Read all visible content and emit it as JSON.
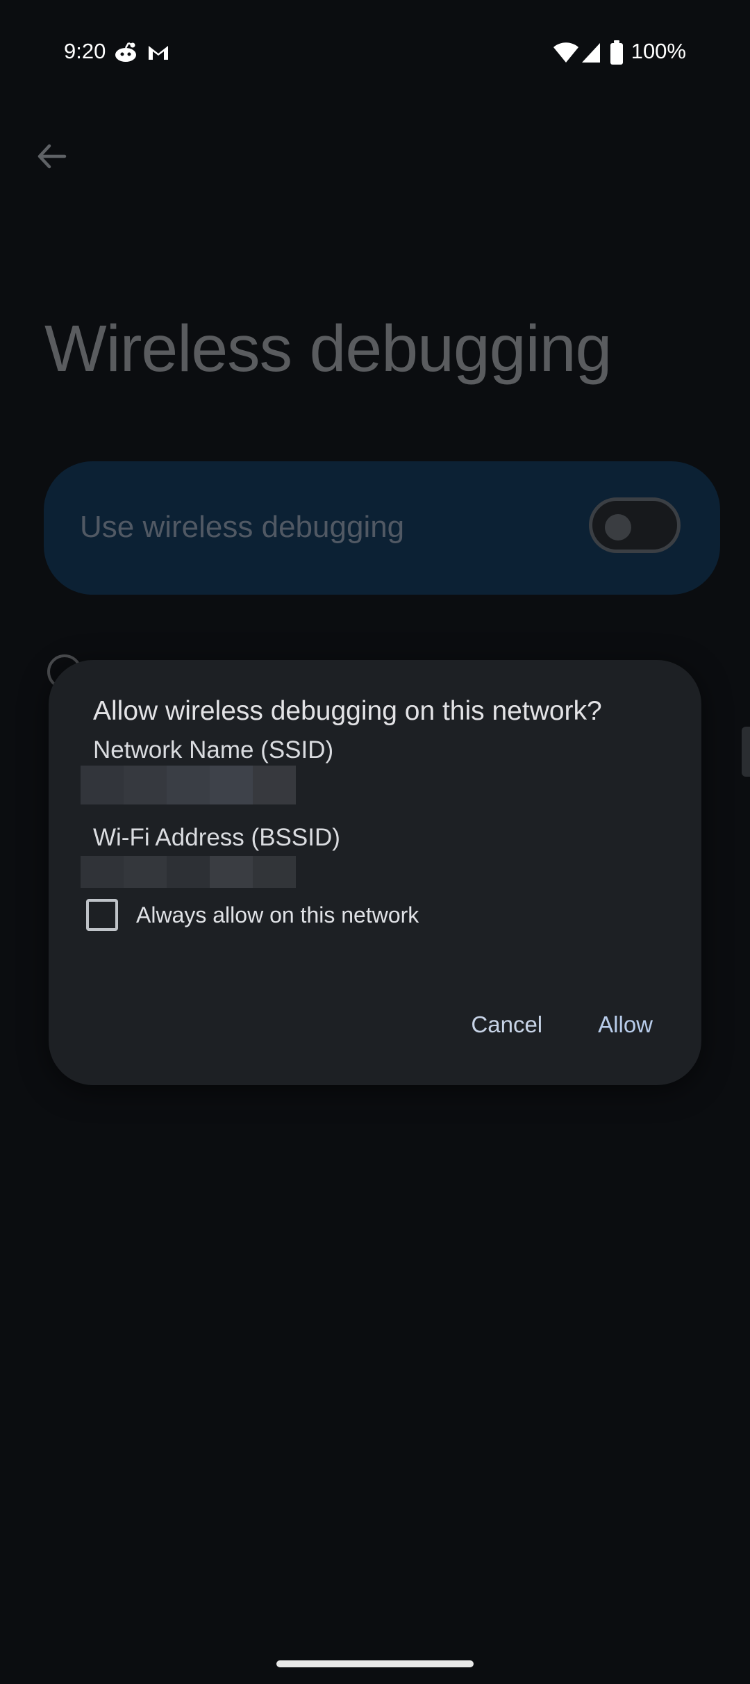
{
  "status_bar": {
    "time": "9:20",
    "notification_icons": [
      "reddit-icon",
      "gmail-icon"
    ],
    "system_icons": [
      "wifi-icon",
      "cell-signal-icon",
      "battery-icon"
    ],
    "battery_percent": "100%"
  },
  "app_bar": {
    "back_icon": "arrow-back-icon"
  },
  "page": {
    "title": "Wireless debugging"
  },
  "main_toggle": {
    "label": "Use wireless debugging",
    "enabled": false
  },
  "dialog": {
    "title": "Allow wireless debugging on this network?",
    "ssid_label": "Network Name (SSID)",
    "bssid_label": "Wi-Fi Address (BSSID)",
    "checkbox_label": "Always allow on this network",
    "checkbox_checked": false,
    "cancel_label": "Cancel",
    "allow_label": "Allow"
  },
  "colors": {
    "background": "#0b0d10",
    "dialog_bg": "#1d2024",
    "toggle_card_bg": "#0c2134",
    "accent_button_text": "#b8ccea"
  }
}
